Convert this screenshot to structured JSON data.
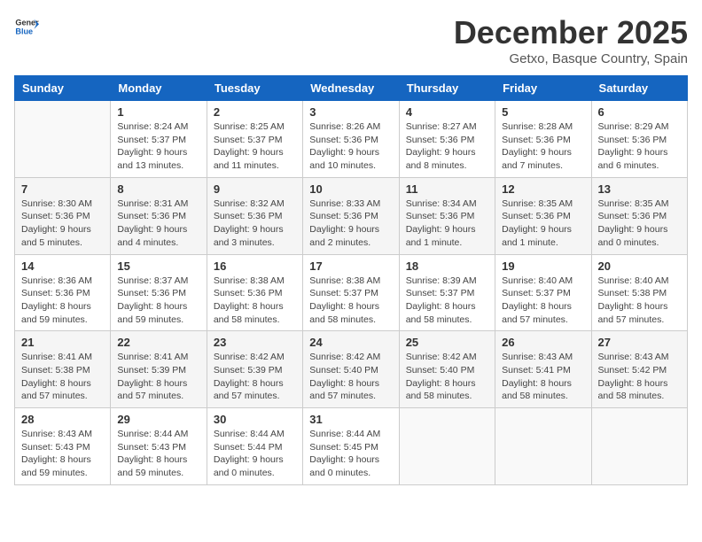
{
  "header": {
    "logo_general": "General",
    "logo_blue": "Blue",
    "month_title": "December 2025",
    "location": "Getxo, Basque Country, Spain"
  },
  "weekdays": [
    "Sunday",
    "Monday",
    "Tuesday",
    "Wednesday",
    "Thursday",
    "Friday",
    "Saturday"
  ],
  "weeks": [
    [
      {
        "day": "",
        "info": ""
      },
      {
        "day": "1",
        "info": "Sunrise: 8:24 AM\nSunset: 5:37 PM\nDaylight: 9 hours\nand 13 minutes."
      },
      {
        "day": "2",
        "info": "Sunrise: 8:25 AM\nSunset: 5:37 PM\nDaylight: 9 hours\nand 11 minutes."
      },
      {
        "day": "3",
        "info": "Sunrise: 8:26 AM\nSunset: 5:36 PM\nDaylight: 9 hours\nand 10 minutes."
      },
      {
        "day": "4",
        "info": "Sunrise: 8:27 AM\nSunset: 5:36 PM\nDaylight: 9 hours\nand 8 minutes."
      },
      {
        "day": "5",
        "info": "Sunrise: 8:28 AM\nSunset: 5:36 PM\nDaylight: 9 hours\nand 7 minutes."
      },
      {
        "day": "6",
        "info": "Sunrise: 8:29 AM\nSunset: 5:36 PM\nDaylight: 9 hours\nand 6 minutes."
      }
    ],
    [
      {
        "day": "7",
        "info": "Sunrise: 8:30 AM\nSunset: 5:36 PM\nDaylight: 9 hours\nand 5 minutes."
      },
      {
        "day": "8",
        "info": "Sunrise: 8:31 AM\nSunset: 5:36 PM\nDaylight: 9 hours\nand 4 minutes."
      },
      {
        "day": "9",
        "info": "Sunrise: 8:32 AM\nSunset: 5:36 PM\nDaylight: 9 hours\nand 3 minutes."
      },
      {
        "day": "10",
        "info": "Sunrise: 8:33 AM\nSunset: 5:36 PM\nDaylight: 9 hours\nand 2 minutes."
      },
      {
        "day": "11",
        "info": "Sunrise: 8:34 AM\nSunset: 5:36 PM\nDaylight: 9 hours\nand 1 minute."
      },
      {
        "day": "12",
        "info": "Sunrise: 8:35 AM\nSunset: 5:36 PM\nDaylight: 9 hours\nand 1 minute."
      },
      {
        "day": "13",
        "info": "Sunrise: 8:35 AM\nSunset: 5:36 PM\nDaylight: 9 hours\nand 0 minutes."
      }
    ],
    [
      {
        "day": "14",
        "info": "Sunrise: 8:36 AM\nSunset: 5:36 PM\nDaylight: 8 hours\nand 59 minutes."
      },
      {
        "day": "15",
        "info": "Sunrise: 8:37 AM\nSunset: 5:36 PM\nDaylight: 8 hours\nand 59 minutes."
      },
      {
        "day": "16",
        "info": "Sunrise: 8:38 AM\nSunset: 5:36 PM\nDaylight: 8 hours\nand 58 minutes."
      },
      {
        "day": "17",
        "info": "Sunrise: 8:38 AM\nSunset: 5:37 PM\nDaylight: 8 hours\nand 58 minutes."
      },
      {
        "day": "18",
        "info": "Sunrise: 8:39 AM\nSunset: 5:37 PM\nDaylight: 8 hours\nand 58 minutes."
      },
      {
        "day": "19",
        "info": "Sunrise: 8:40 AM\nSunset: 5:37 PM\nDaylight: 8 hours\nand 57 minutes."
      },
      {
        "day": "20",
        "info": "Sunrise: 8:40 AM\nSunset: 5:38 PM\nDaylight: 8 hours\nand 57 minutes."
      }
    ],
    [
      {
        "day": "21",
        "info": "Sunrise: 8:41 AM\nSunset: 5:38 PM\nDaylight: 8 hours\nand 57 minutes."
      },
      {
        "day": "22",
        "info": "Sunrise: 8:41 AM\nSunset: 5:39 PM\nDaylight: 8 hours\nand 57 minutes."
      },
      {
        "day": "23",
        "info": "Sunrise: 8:42 AM\nSunset: 5:39 PM\nDaylight: 8 hours\nand 57 minutes."
      },
      {
        "day": "24",
        "info": "Sunrise: 8:42 AM\nSunset: 5:40 PM\nDaylight: 8 hours\nand 57 minutes."
      },
      {
        "day": "25",
        "info": "Sunrise: 8:42 AM\nSunset: 5:40 PM\nDaylight: 8 hours\nand 58 minutes."
      },
      {
        "day": "26",
        "info": "Sunrise: 8:43 AM\nSunset: 5:41 PM\nDaylight: 8 hours\nand 58 minutes."
      },
      {
        "day": "27",
        "info": "Sunrise: 8:43 AM\nSunset: 5:42 PM\nDaylight: 8 hours\nand 58 minutes."
      }
    ],
    [
      {
        "day": "28",
        "info": "Sunrise: 8:43 AM\nSunset: 5:43 PM\nDaylight: 8 hours\nand 59 minutes."
      },
      {
        "day": "29",
        "info": "Sunrise: 8:44 AM\nSunset: 5:43 PM\nDaylight: 8 hours\nand 59 minutes."
      },
      {
        "day": "30",
        "info": "Sunrise: 8:44 AM\nSunset: 5:44 PM\nDaylight: 9 hours\nand 0 minutes."
      },
      {
        "day": "31",
        "info": "Sunrise: 8:44 AM\nSunset: 5:45 PM\nDaylight: 9 hours\nand 0 minutes."
      },
      {
        "day": "",
        "info": ""
      },
      {
        "day": "",
        "info": ""
      },
      {
        "day": "",
        "info": ""
      }
    ]
  ]
}
